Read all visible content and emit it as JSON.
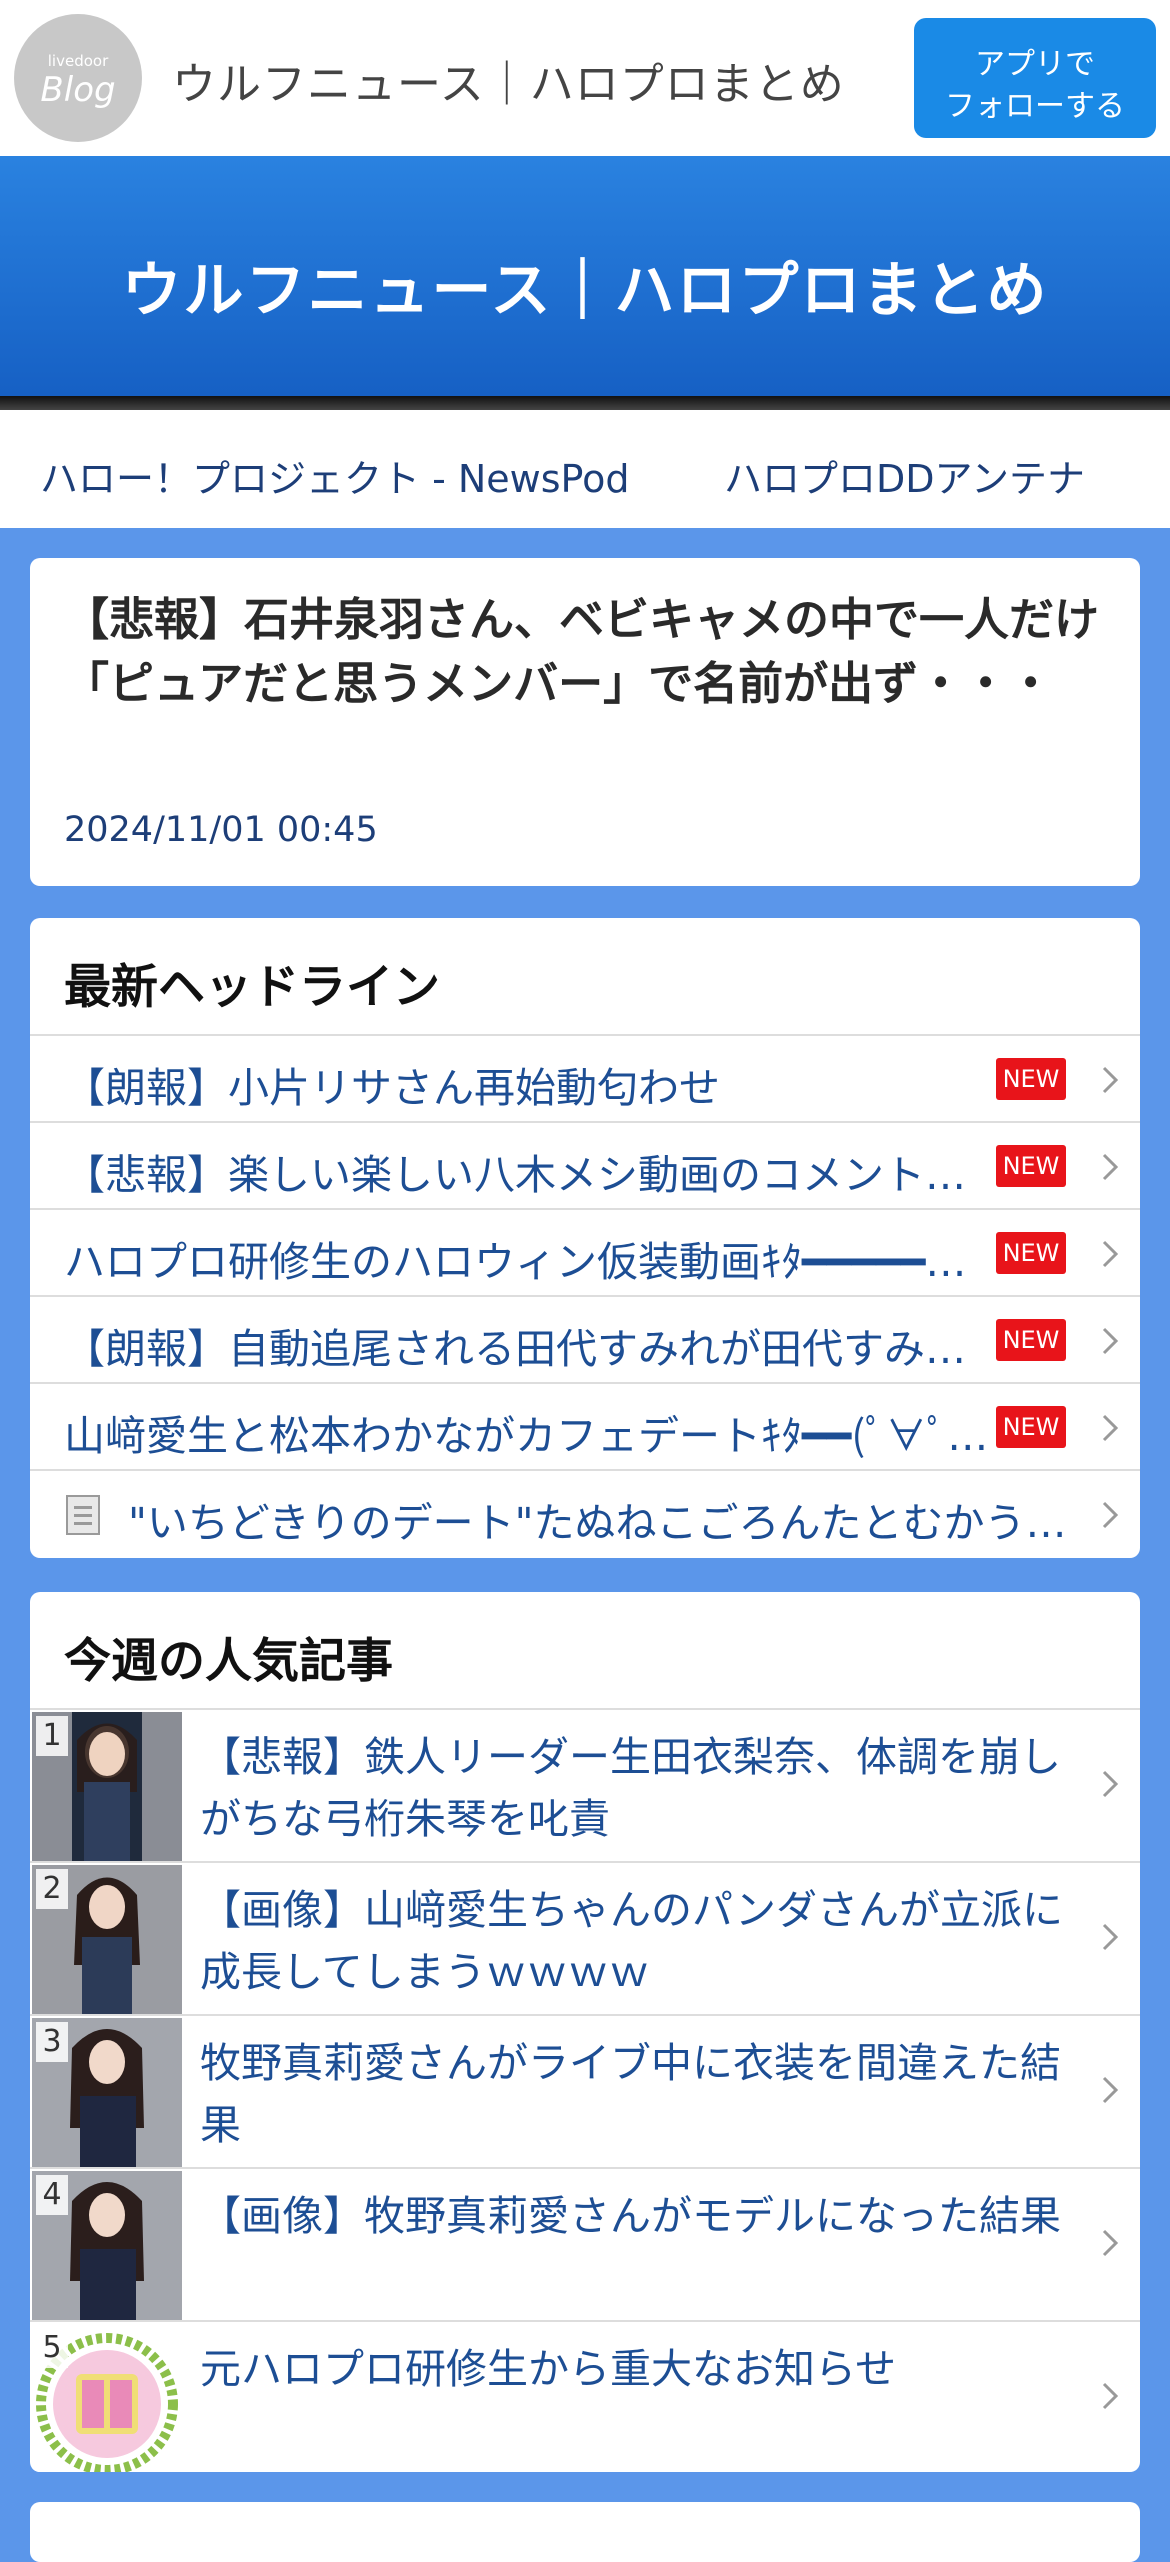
{
  "header": {
    "logo_small": "livedoor",
    "logo_big": "Blog",
    "site_name": "ウルフニュース｜ハロプロまとめ",
    "follow_button": "アプリで\nフォローする"
  },
  "banner": {
    "title": "ウルフニュース｜ハロプロまとめ"
  },
  "nav_links": [
    "ハロー！プロジェクト - NewsPod",
    "ハロプロDDアンテナ"
  ],
  "article": {
    "title": "【悲報】石井泉羽さん、ベビキャメの中で一人だけ「ピュアだと思うメンバー」で名前が出ず・・・",
    "date": "2024/11/01 00:45"
  },
  "headlines": {
    "heading": "最新ヘッドライン",
    "new_label": "NEW",
    "items": [
      {
        "text": "【朗報】小片リサさん再始動匂わせ",
        "new": true
      },
      {
        "text": "【悲報】楽しい楽しい八木メシ動画のコメント欄が荒れる",
        "new": true
      },
      {
        "text": "ハロプロ研修生のハロウィン仮装動画ｷﾀ━━━━━(ﾟ∀ﾟ)━━━━━!!",
        "new": true
      },
      {
        "text": "【朗報】自動追尾される田代すみれが田代すみれすぎる",
        "new": true
      },
      {
        "text": "山﨑愛生と松本わかながカフェデートｷﾀ━━(ﾟ∀ﾟ)━━!!",
        "new": true
      },
      {
        "text": "\"いちどきりのデート\"たぬねこごろんたとむかうパーク",
        "new": false
      }
    ]
  },
  "popular": {
    "heading": "今週の人気記事",
    "items": [
      {
        "rank": "1",
        "title": "【悲報】鉄人リーダー生田衣梨奈、体調を崩しがちな弓桁朱琴を叱責"
      },
      {
        "rank": "2",
        "title": "【画像】山﨑愛生ちゃんのパンダさんが立派に成長してしまうｗｗｗｗ"
      },
      {
        "rank": "3",
        "title": "牧野真莉愛さんがライブ中に衣装を間違えた結果"
      },
      {
        "rank": "4",
        "title": "【画像】牧野真莉愛さんがモデルになった結果"
      },
      {
        "rank": "5",
        "title": "元ハロプロ研修生から重大なお知らせ"
      }
    ]
  },
  "colors": {
    "page_bg": "#5b96ea",
    "banner": "#1d72d6",
    "link": "#1d4e94",
    "follow_button": "#1a8ae6",
    "new_badge": "#e8141a"
  }
}
